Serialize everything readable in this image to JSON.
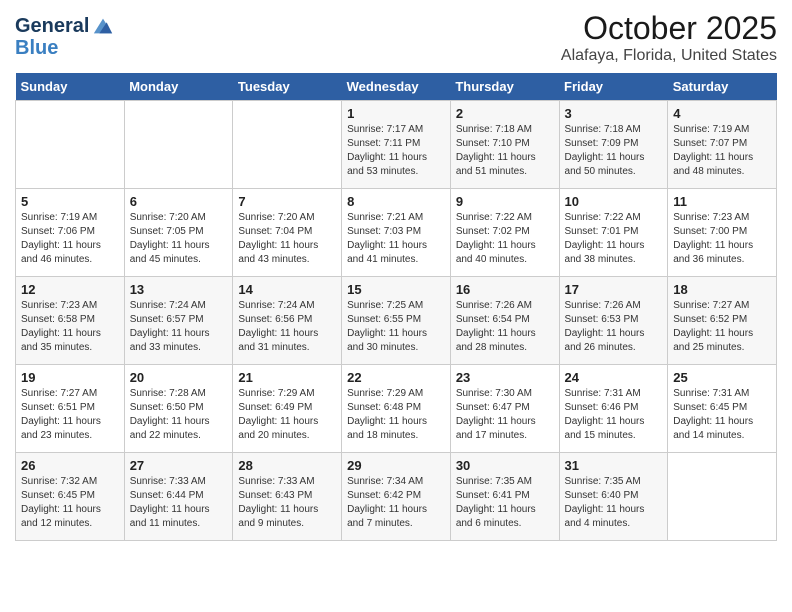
{
  "app": {
    "logo_line1": "General",
    "logo_line2": "Blue"
  },
  "title": "October 2025",
  "subtitle": "Alafaya, Florida, United States",
  "headers": [
    "Sunday",
    "Monday",
    "Tuesday",
    "Wednesday",
    "Thursday",
    "Friday",
    "Saturday"
  ],
  "weeks": [
    [
      {
        "day": "",
        "sunrise": "",
        "sunset": "",
        "daylight": ""
      },
      {
        "day": "",
        "sunrise": "",
        "sunset": "",
        "daylight": ""
      },
      {
        "day": "",
        "sunrise": "",
        "sunset": "",
        "daylight": ""
      },
      {
        "day": "1",
        "sunrise": "Sunrise: 7:17 AM",
        "sunset": "Sunset: 7:11 PM",
        "daylight": "Daylight: 11 hours and 53 minutes."
      },
      {
        "day": "2",
        "sunrise": "Sunrise: 7:18 AM",
        "sunset": "Sunset: 7:10 PM",
        "daylight": "Daylight: 11 hours and 51 minutes."
      },
      {
        "day": "3",
        "sunrise": "Sunrise: 7:18 AM",
        "sunset": "Sunset: 7:09 PM",
        "daylight": "Daylight: 11 hours and 50 minutes."
      },
      {
        "day": "4",
        "sunrise": "Sunrise: 7:19 AM",
        "sunset": "Sunset: 7:07 PM",
        "daylight": "Daylight: 11 hours and 48 minutes."
      }
    ],
    [
      {
        "day": "5",
        "sunrise": "Sunrise: 7:19 AM",
        "sunset": "Sunset: 7:06 PM",
        "daylight": "Daylight: 11 hours and 46 minutes."
      },
      {
        "day": "6",
        "sunrise": "Sunrise: 7:20 AM",
        "sunset": "Sunset: 7:05 PM",
        "daylight": "Daylight: 11 hours and 45 minutes."
      },
      {
        "day": "7",
        "sunrise": "Sunrise: 7:20 AM",
        "sunset": "Sunset: 7:04 PM",
        "daylight": "Daylight: 11 hours and 43 minutes."
      },
      {
        "day": "8",
        "sunrise": "Sunrise: 7:21 AM",
        "sunset": "Sunset: 7:03 PM",
        "daylight": "Daylight: 11 hours and 41 minutes."
      },
      {
        "day": "9",
        "sunrise": "Sunrise: 7:22 AM",
        "sunset": "Sunset: 7:02 PM",
        "daylight": "Daylight: 11 hours and 40 minutes."
      },
      {
        "day": "10",
        "sunrise": "Sunrise: 7:22 AM",
        "sunset": "Sunset: 7:01 PM",
        "daylight": "Daylight: 11 hours and 38 minutes."
      },
      {
        "day": "11",
        "sunrise": "Sunrise: 7:23 AM",
        "sunset": "Sunset: 7:00 PM",
        "daylight": "Daylight: 11 hours and 36 minutes."
      }
    ],
    [
      {
        "day": "12",
        "sunrise": "Sunrise: 7:23 AM",
        "sunset": "Sunset: 6:58 PM",
        "daylight": "Daylight: 11 hours and 35 minutes."
      },
      {
        "day": "13",
        "sunrise": "Sunrise: 7:24 AM",
        "sunset": "Sunset: 6:57 PM",
        "daylight": "Daylight: 11 hours and 33 minutes."
      },
      {
        "day": "14",
        "sunrise": "Sunrise: 7:24 AM",
        "sunset": "Sunset: 6:56 PM",
        "daylight": "Daylight: 11 hours and 31 minutes."
      },
      {
        "day": "15",
        "sunrise": "Sunrise: 7:25 AM",
        "sunset": "Sunset: 6:55 PM",
        "daylight": "Daylight: 11 hours and 30 minutes."
      },
      {
        "day": "16",
        "sunrise": "Sunrise: 7:26 AM",
        "sunset": "Sunset: 6:54 PM",
        "daylight": "Daylight: 11 hours and 28 minutes."
      },
      {
        "day": "17",
        "sunrise": "Sunrise: 7:26 AM",
        "sunset": "Sunset: 6:53 PM",
        "daylight": "Daylight: 11 hours and 26 minutes."
      },
      {
        "day": "18",
        "sunrise": "Sunrise: 7:27 AM",
        "sunset": "Sunset: 6:52 PM",
        "daylight": "Daylight: 11 hours and 25 minutes."
      }
    ],
    [
      {
        "day": "19",
        "sunrise": "Sunrise: 7:27 AM",
        "sunset": "Sunset: 6:51 PM",
        "daylight": "Daylight: 11 hours and 23 minutes."
      },
      {
        "day": "20",
        "sunrise": "Sunrise: 7:28 AM",
        "sunset": "Sunset: 6:50 PM",
        "daylight": "Daylight: 11 hours and 22 minutes."
      },
      {
        "day": "21",
        "sunrise": "Sunrise: 7:29 AM",
        "sunset": "Sunset: 6:49 PM",
        "daylight": "Daylight: 11 hours and 20 minutes."
      },
      {
        "day": "22",
        "sunrise": "Sunrise: 7:29 AM",
        "sunset": "Sunset: 6:48 PM",
        "daylight": "Daylight: 11 hours and 18 minutes."
      },
      {
        "day": "23",
        "sunrise": "Sunrise: 7:30 AM",
        "sunset": "Sunset: 6:47 PM",
        "daylight": "Daylight: 11 hours and 17 minutes."
      },
      {
        "day": "24",
        "sunrise": "Sunrise: 7:31 AM",
        "sunset": "Sunset: 6:46 PM",
        "daylight": "Daylight: 11 hours and 15 minutes."
      },
      {
        "day": "25",
        "sunrise": "Sunrise: 7:31 AM",
        "sunset": "Sunset: 6:45 PM",
        "daylight": "Daylight: 11 hours and 14 minutes."
      }
    ],
    [
      {
        "day": "26",
        "sunrise": "Sunrise: 7:32 AM",
        "sunset": "Sunset: 6:45 PM",
        "daylight": "Daylight: 11 hours and 12 minutes."
      },
      {
        "day": "27",
        "sunrise": "Sunrise: 7:33 AM",
        "sunset": "Sunset: 6:44 PM",
        "daylight": "Daylight: 11 hours and 11 minutes."
      },
      {
        "day": "28",
        "sunrise": "Sunrise: 7:33 AM",
        "sunset": "Sunset: 6:43 PM",
        "daylight": "Daylight: 11 hours and 9 minutes."
      },
      {
        "day": "29",
        "sunrise": "Sunrise: 7:34 AM",
        "sunset": "Sunset: 6:42 PM",
        "daylight": "Daylight: 11 hours and 7 minutes."
      },
      {
        "day": "30",
        "sunrise": "Sunrise: 7:35 AM",
        "sunset": "Sunset: 6:41 PM",
        "daylight": "Daylight: 11 hours and 6 minutes."
      },
      {
        "day": "31",
        "sunrise": "Sunrise: 7:35 AM",
        "sunset": "Sunset: 6:40 PM",
        "daylight": "Daylight: 11 hours and 4 minutes."
      },
      {
        "day": "",
        "sunrise": "",
        "sunset": "",
        "daylight": ""
      }
    ]
  ]
}
